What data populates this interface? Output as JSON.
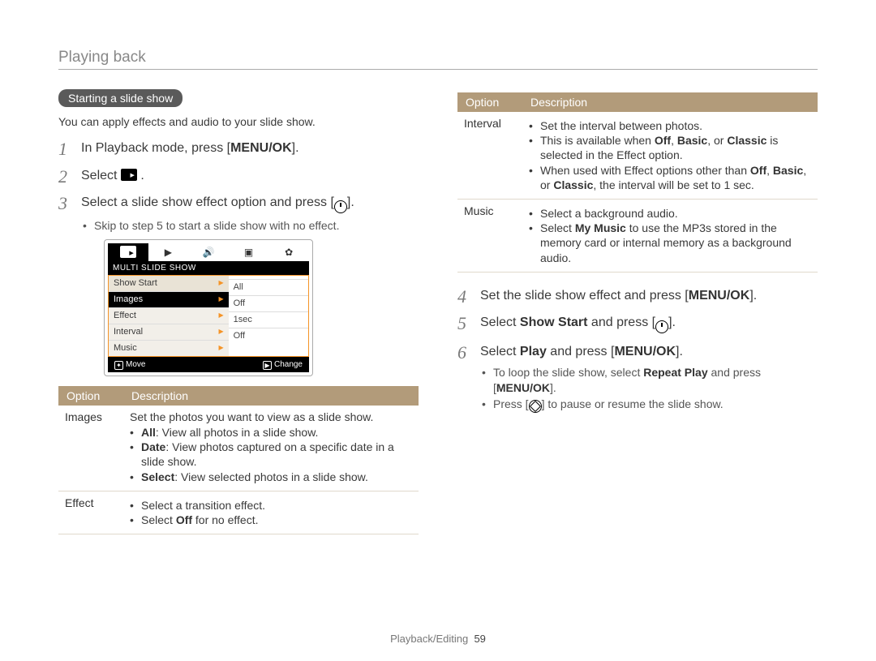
{
  "header": {
    "title": "Playing back"
  },
  "section_pill": "Starting a slide show",
  "intro": "You can apply effects and audio to your slide show.",
  "steps_left": {
    "s1_a": "In Playback mode, press [",
    "s1_b": "MENU/OK",
    "s1_c": "].",
    "s2": "Select ",
    "s3_a": "Select a slide show effect option and press [",
    "s3_b": "].",
    "s3_sub": "Skip to step 5 to start a slide show with no effect."
  },
  "cam": {
    "title": "MULTI SLIDE SHOW",
    "rows": [
      {
        "label": "Show Start",
        "value": ""
      },
      {
        "label": "Images",
        "value": "All"
      },
      {
        "label": "Effect",
        "value": "Off"
      },
      {
        "label": "Interval",
        "value": "1sec"
      },
      {
        "label": "Music",
        "value": "Off"
      }
    ],
    "foot_move": "Move",
    "foot_change": "Change"
  },
  "table_header": {
    "option": "Option",
    "description": "Description"
  },
  "table_left": [
    {
      "name": "Images",
      "lead": "Set the photos you want to view as a slide show.",
      "bullets": [
        {
          "bold": "All",
          "rest": ": View all photos in a slide show."
        },
        {
          "bold": "Date",
          "rest": ": View photos captured on a specific date in a slide show."
        },
        {
          "bold": "Select",
          "rest": ": View selected photos in a slide show."
        }
      ]
    },
    {
      "name": "Effect",
      "bullets_plain": [
        "Select a transition effect.",
        "Select Off for no effect."
      ],
      "bold_in_second": "Off"
    }
  ],
  "table_right": [
    {
      "name": "Interval",
      "bullets_rich": [
        "Set the interval between photos.",
        "This is available when Off, Basic, or Classic is selected in the Effect option.",
        "When used with Effect options other than Off, Basic, or Classic, the interval will be set to 1 sec."
      ]
    },
    {
      "name": "Music",
      "bullets_rich": [
        "Select a background audio.",
        "Select My Music to use the MP3s stored in the memory card or internal memory as a background audio."
      ]
    }
  ],
  "steps_right": {
    "s4_a": "Set the slide show effect and press [",
    "s4_b": "MENU/OK",
    "s4_c": "].",
    "s5_a": "Select ",
    "s5_b": "Show Start",
    "s5_c": " and press [",
    "s5_d": "].",
    "s6_a": "Select ",
    "s6_b": "Play",
    "s6_c": " and press [",
    "s6_d": "MENU/OK",
    "s6_e": "].",
    "s6_sub1_a": "To loop the slide show, select ",
    "s6_sub1_b": "Repeat Play",
    "s6_sub1_c": " and press [",
    "s6_sub1_d": "MENU/OK",
    "s6_sub1_e": "].",
    "s6_sub2_a": "Press [",
    "s6_sub2_b": "] to pause or resume the slide show."
  },
  "footer": {
    "section": "Playback/Editing",
    "page": "59"
  }
}
